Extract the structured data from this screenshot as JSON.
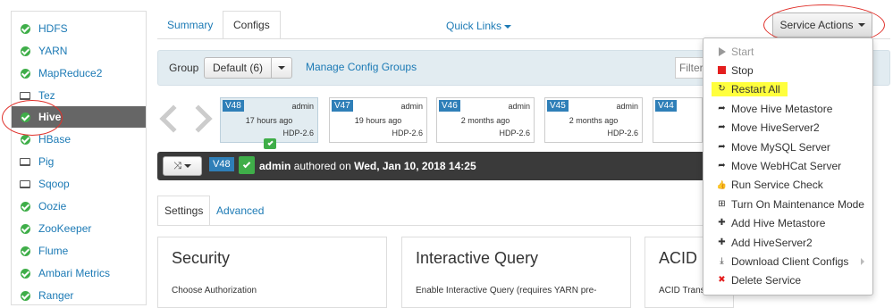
{
  "sidebar": {
    "items": [
      {
        "label": "HDFS",
        "icon": "check-circle-icon"
      },
      {
        "label": "YARN",
        "icon": "check-circle-icon"
      },
      {
        "label": "MapReduce2",
        "icon": "check-circle-icon"
      },
      {
        "label": "Tez",
        "icon": "laptop-icon"
      },
      {
        "label": "Hive",
        "icon": "check-circle-icon",
        "active": true
      },
      {
        "label": "HBase",
        "icon": "check-circle-icon"
      },
      {
        "label": "Pig",
        "icon": "laptop-icon"
      },
      {
        "label": "Sqoop",
        "icon": "laptop-icon"
      },
      {
        "label": "Oozie",
        "icon": "check-circle-icon"
      },
      {
        "label": "ZooKeeper",
        "icon": "check-circle-icon"
      },
      {
        "label": "Flume",
        "icon": "check-circle-icon"
      },
      {
        "label": "Ambari Metrics",
        "icon": "check-circle-icon"
      },
      {
        "label": "Ranger",
        "icon": "check-circle-icon"
      }
    ]
  },
  "tabs": {
    "summary": "Summary",
    "configs": "Configs",
    "active": "Configs"
  },
  "quick_links": "Quick Links",
  "service_actions": {
    "label": "Service Actions",
    "menu": [
      {
        "label": "Start",
        "icon": "play-icon",
        "disabled": true
      },
      {
        "label": "Stop",
        "icon": "stop-icon"
      },
      {
        "label": "Restart All",
        "icon": "refresh-icon",
        "highlighted": true
      },
      {
        "label": "Move Hive Metastore",
        "icon": "share-arrow-icon"
      },
      {
        "label": "Move HiveServer2",
        "icon": "share-arrow-icon"
      },
      {
        "label": "Move MySQL Server",
        "icon": "share-arrow-icon"
      },
      {
        "label": "Move WebHCat Server",
        "icon": "share-arrow-icon"
      },
      {
        "label": "Run Service Check",
        "icon": "thumbs-up-icon"
      },
      {
        "label": "Turn On Maintenance Mode",
        "icon": "medkit-icon"
      },
      {
        "label": "Add Hive Metastore",
        "icon": "plus-icon"
      },
      {
        "label": "Add HiveServer2",
        "icon": "plus-icon"
      },
      {
        "label": "Download Client Configs",
        "icon": "download-icon",
        "has_submenu": true
      },
      {
        "label": "Delete Service",
        "icon": "delete-x-icon"
      }
    ]
  },
  "group_bar": {
    "label": "Group",
    "selected": "Default (6)",
    "manage_link": "Manage Config Groups",
    "filter_placeholder": "Filter"
  },
  "versions": [
    {
      "tag": "V48",
      "user": "admin",
      "time": "17 hours ago",
      "stack": "HDP-2.6",
      "current": true
    },
    {
      "tag": "V47",
      "user": "admin",
      "time": "19 hours ago",
      "stack": "HDP-2.6"
    },
    {
      "tag": "V46",
      "user": "admin",
      "time": "2 months ago",
      "stack": "HDP-2.6"
    },
    {
      "tag": "V45",
      "user": "admin",
      "time": "2 months ago",
      "stack": "HDP-2.6"
    },
    {
      "tag": "V44",
      "user": "",
      "time": "",
      "stack": ""
    }
  ],
  "current_version": {
    "tag": "V48",
    "user": "admin",
    "authored_text": "authored on",
    "date": "Wed, Jan 10, 2018 14:25"
  },
  "settings_tabs": {
    "settings": "Settings",
    "advanced": "Advanced"
  },
  "cards": [
    {
      "title": "Security",
      "subtitle": "Choose Authorization"
    },
    {
      "title": "Interactive Query",
      "subtitle": "Enable Interactive Query (requires YARN pre-"
    },
    {
      "title": "ACID",
      "subtitle": "ACID Transactions"
    }
  ],
  "colors": {
    "link": "#1c7ab5",
    "ok_green": "#3fae49",
    "version_blue": "#2f7fb8",
    "annotation_red": "#e0312b",
    "highlight_yellow": "#ffff3d",
    "stop_red": "#e41e1e"
  }
}
